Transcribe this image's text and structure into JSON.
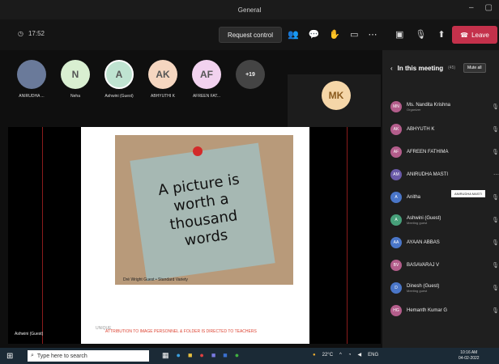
{
  "window": {
    "title": "General",
    "controls": [
      "–",
      "▢"
    ]
  },
  "toolbar": {
    "timer": "17:52",
    "request_control": "Request control",
    "leave_label": "Leave",
    "icons": [
      "people-icon",
      "chat-icon",
      "reactions-icon",
      "rooms-icon",
      "more-icon",
      "camera-off-icon",
      "mic-off-icon",
      "share-icon"
    ]
  },
  "avatars": [
    {
      "initials": "",
      "name": "ANIRUDHA ...",
      "color": "#6a7a9a"
    },
    {
      "initials": "N",
      "name": "Neha",
      "color": "#d9efd1"
    },
    {
      "initials": "A",
      "name": "Ashwini (Guest)",
      "color": "#bfe3d1"
    },
    {
      "initials": "AK",
      "name": "ABHYUTHI K",
      "color": "#f5d6c0"
    },
    {
      "initials": "AF",
      "name": "AFREEN FAT...",
      "color": "#f2d2ef"
    },
    {
      "initials": "+19",
      "name": "",
      "color": "#444"
    }
  ],
  "mk_tile": {
    "initials": "MK"
  },
  "slide": {
    "note_lines": [
      "A picture is",
      "worth a",
      "thousand",
      "words"
    ],
    "caption": "Dré Wright Guest • Standard Variety",
    "footer": "ATTRIBUTION TO IMAGE PERSONNEL & FOLDER IS DIRECTED TO TEACHERS",
    "footer_small": "UNIQUE"
  },
  "presenter": "Ashwini (Guest)",
  "panel": {
    "title": "In this meeting",
    "count": "(45)",
    "mute_all": "Mute all",
    "tooltip": "ANIRUDHA MASTI",
    "participants": [
      {
        "initials": "MN",
        "name": "Ms. Nandita Krishna",
        "sub": "Organizer",
        "color": "#b35d8b"
      },
      {
        "initials": "AK",
        "name": "ABHYUTH K",
        "sub": "",
        "color": "#b35d8b"
      },
      {
        "initials": "AF",
        "name": "AFREEN FATHIMA",
        "sub": "",
        "color": "#b35d8b"
      },
      {
        "initials": "AM",
        "name": "ANIRUDHA MASTI",
        "sub": "",
        "color": "#6a5aa8"
      },
      {
        "initials": "A",
        "name": "Anitha",
        "sub": "",
        "color": "#4a76c8"
      },
      {
        "initials": "A",
        "name": "Ashwini (Guest)",
        "sub": "Meeting guest",
        "color": "#47a07a"
      },
      {
        "initials": "AA",
        "name": "AYAAN ABBAS",
        "sub": "",
        "color": "#4a76c8"
      },
      {
        "initials": "BV",
        "name": "BASAVARAJ V",
        "sub": "",
        "color": "#b35d8b"
      },
      {
        "initials": "D",
        "name": "Dinesh (Guest)",
        "sub": "Meeting guest",
        "color": "#4a76c8"
      },
      {
        "initials": "HG",
        "name": "Hemanth Kumar G",
        "sub": "",
        "color": "#b35d8b"
      }
    ]
  },
  "taskbar": {
    "search_placeholder": "Type here to search",
    "weather": "22°C",
    "lang": "ENG",
    "time": "10:16 AM",
    "date": "04-02-2022"
  }
}
